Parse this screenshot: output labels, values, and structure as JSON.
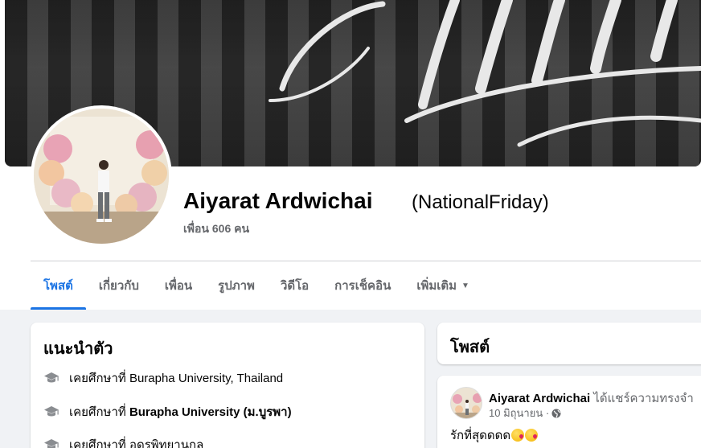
{
  "profile": {
    "name": "Aiyarat Ardwichai",
    "nickname": "(NationalFriday)",
    "friends": "เพื่อน 606 คน"
  },
  "tabs": [
    {
      "label": "โพสต์",
      "active": true
    },
    {
      "label": "เกี่ยวกับ"
    },
    {
      "label": "เพื่อน"
    },
    {
      "label": "รูปภาพ"
    },
    {
      "label": "วิดีโอ"
    },
    {
      "label": "การเช็คอิน"
    },
    {
      "label": "เพิ่มเติม"
    }
  ],
  "intro": {
    "title": "แนะนำตัว",
    "items": [
      {
        "prefix": "เคยศึกษาที่",
        "value": "Burapha University, Thailand",
        "bold": false
      },
      {
        "prefix": "เคยศึกษาที่",
        "value": "Burapha University (ม.บูรพา)",
        "bold": true
      },
      {
        "prefix": "เคยศึกษาที่",
        "value": "อุดรพิทยานุกูล",
        "bold": false
      }
    ]
  },
  "posts": {
    "title": "โพสต์",
    "first": {
      "author": "Aiyarat Ardwichai",
      "action": "ได้แชร์ความทรงจำ",
      "date": "10 มิถุนายน",
      "separator": "·",
      "text": "รักที่สุดดดด"
    }
  },
  "colors": {
    "accent": "#1b74e4",
    "muted": "#65676b",
    "background": "#f0f2f5"
  },
  "icons": {
    "education": "graduation-cap-icon",
    "privacy": "globe-icon",
    "more": "caret-down-icon"
  }
}
